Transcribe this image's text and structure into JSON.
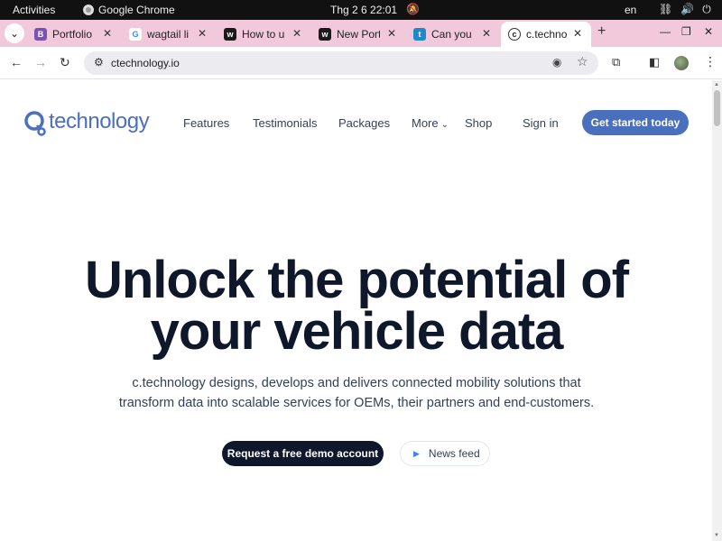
{
  "system": {
    "activities": "Activities",
    "app_name": "Google Chrome",
    "clock": "Thg 2 6  22:01",
    "lang": "en"
  },
  "browser": {
    "tabs": [
      {
        "label": "Portfolio",
        "favicon": "B",
        "favicon_color": "#7952b3"
      },
      {
        "label": "wagtail li",
        "favicon": "G",
        "favicon_color": "#4285f4"
      },
      {
        "label": "How to u",
        "favicon": "w",
        "favicon_color": "#1a1a1a"
      },
      {
        "label": "New Port",
        "favicon": "w",
        "favicon_color": "#1a1a1a"
      },
      {
        "label": "Can you f",
        "favicon": "t",
        "favicon_color": "#1e88c8"
      },
      {
        "label": "c.techno",
        "favicon": "c",
        "favicon_color": "#ffffff",
        "active": true
      }
    ],
    "url": "ctechnology.io"
  },
  "site": {
    "logo_text": "technology",
    "nav": {
      "features": "Features",
      "testimonials": "Testimonials",
      "packages": "Packages",
      "more": "More",
      "shop": "Shop",
      "sign_in": "Sign in",
      "cta": "Get started today"
    },
    "hero": {
      "title_line1": "Unlock the potential of",
      "title_line2": "your vehicle data",
      "desc_line1": "c.technology designs, develops and delivers connected mobility solutions that",
      "desc_line2": "transform data into scalable services for OEMs, their partners and end-customers.",
      "demo_button": "Request a free demo account",
      "news_button": "News feed"
    }
  },
  "colors": {
    "brand_blue": "#4a6fbd",
    "hero_text": "#0f172a",
    "tab_strip": "#f2c9da"
  }
}
